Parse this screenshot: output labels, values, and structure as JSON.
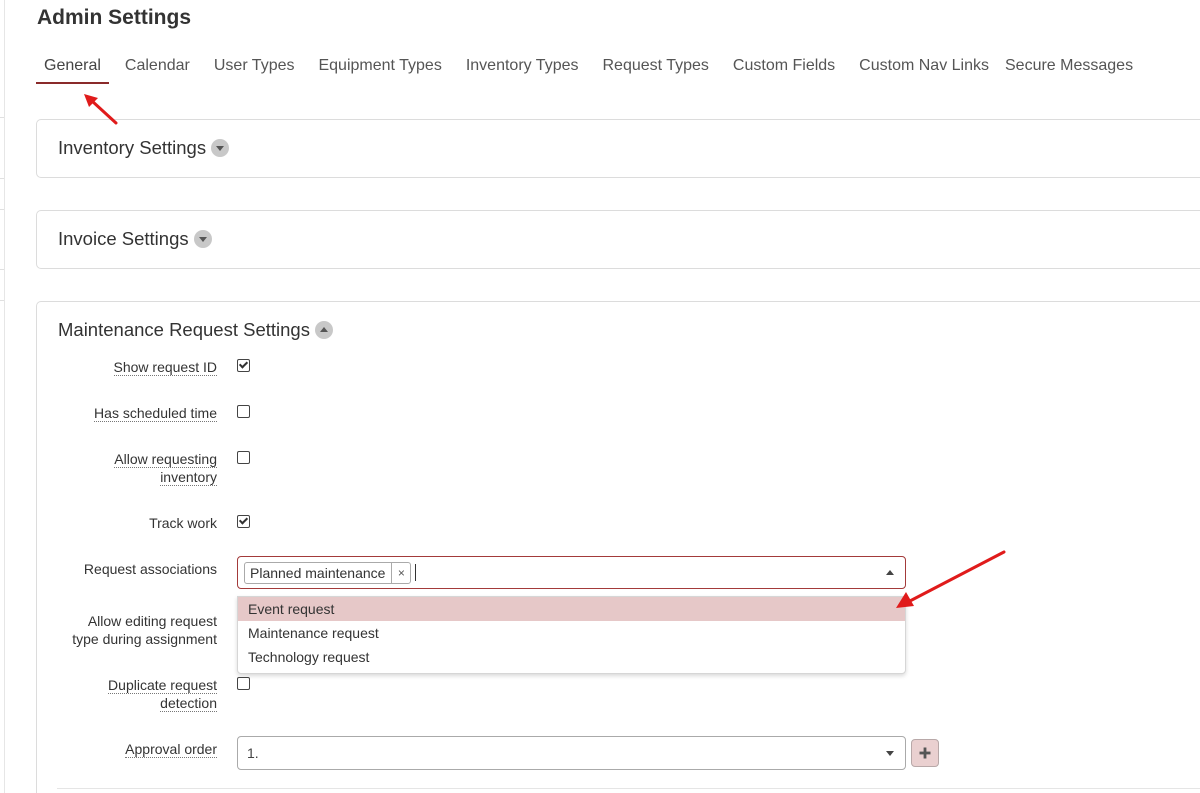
{
  "page": {
    "title": "Admin Settings"
  },
  "tabs": [
    {
      "label": "General",
      "active": true
    },
    {
      "label": "Calendar"
    },
    {
      "label": "User Types"
    },
    {
      "label": "Equipment Types"
    },
    {
      "label": "Inventory Types"
    },
    {
      "label": "Request Types"
    },
    {
      "label": "Custom Fields"
    },
    {
      "label": "Custom Nav Links"
    },
    {
      "label": "Secure Messages"
    }
  ],
  "panels": {
    "inventory": {
      "title": "Inventory Settings",
      "expanded": false
    },
    "invoice": {
      "title": "Invoice Settings",
      "expanded": false
    },
    "maintenance": {
      "title": "Maintenance Request Settings",
      "expanded": true
    }
  },
  "maintenance": {
    "show_request_id": {
      "label": "Show request ID",
      "checked": true
    },
    "has_scheduled_time": {
      "label": "Has scheduled time",
      "checked": false
    },
    "allow_requesting_inventory": {
      "label_line1": "Allow requesting",
      "label_line2": "inventory",
      "checked": false
    },
    "track_work": {
      "label": "Track work",
      "checked": true
    },
    "request_associations": {
      "label": "Request associations",
      "selected": [
        "Planned maintenance"
      ],
      "remove_glyph": "×",
      "options": [
        "Event request",
        "Maintenance request",
        "Technology request"
      ],
      "highlighted_option": "Event request"
    },
    "allow_editing_request_type": {
      "label_line1": "Allow editing request",
      "label_line2": "type during assignment"
    },
    "duplicate_request_detection": {
      "label_line1": "Duplicate request",
      "label_line2": "detection",
      "checked": false
    },
    "approval_order": {
      "label": "Approval order",
      "value": "1."
    }
  },
  "colors": {
    "accent": "#8a2a2a",
    "annotation_arrow": "#e01b1b",
    "highlight": "#e6c8c8"
  },
  "icons": {
    "collapsed_toggle": "caret-down-icon",
    "expanded_toggle": "caret-up-icon",
    "add": "plus-icon",
    "remove_chip": "close-icon"
  }
}
